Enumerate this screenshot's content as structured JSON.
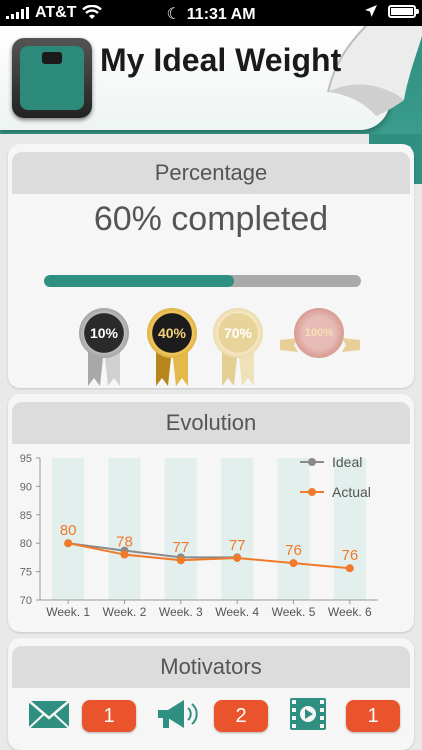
{
  "status_bar": {
    "carrier": "AT&T",
    "time": "11:31 AM"
  },
  "app": {
    "title": "My Ideal Weight",
    "icons": {
      "app_icon": "scale-icon",
      "menu": "hamburger-menu-icon"
    }
  },
  "percentage": {
    "header": "Percentage",
    "text": "60% completed",
    "progress_fraction": 0.6,
    "medals": [
      {
        "label": "10%",
        "style": "silver"
      },
      {
        "label": "40%",
        "style": "gold"
      },
      {
        "label": "70%",
        "style": "pale-gold"
      },
      {
        "label": "100%",
        "style": "rose-gold"
      }
    ]
  },
  "evolution": {
    "header": "Evolution",
    "chart_data": {
      "type": "line",
      "categories": [
        "Week. 1",
        "Week. 2",
        "Week. 3",
        "Week. 4",
        "Week. 5",
        "Week. 6"
      ],
      "ylim": [
        70,
        95
      ],
      "yticks": [
        70,
        75,
        80,
        85,
        90,
        95
      ],
      "legend_position": "top-right",
      "series": [
        {
          "name": "Ideal",
          "color": "#8a8a8a",
          "values": [
            80,
            78.7,
            77.5,
            77.5,
            null,
            null
          ]
        },
        {
          "name": "Actual",
          "color": "#f07a2a",
          "values": [
            80,
            78,
            77,
            77.4,
            76.5,
            75.6
          ],
          "labels": [
            "80",
            "78",
            "77",
            "77",
            "76",
            "76"
          ]
        }
      ]
    }
  },
  "motivators": {
    "header": "Motivators",
    "items": [
      {
        "icon": "envelope-icon",
        "count": "1"
      },
      {
        "icon": "megaphone-icon",
        "count": "2"
      },
      {
        "icon": "video-icon",
        "count": "1"
      }
    ]
  },
  "colors": {
    "brand": "#2f8f80",
    "accent": "#e9542c",
    "actual_line": "#f07a2a"
  }
}
